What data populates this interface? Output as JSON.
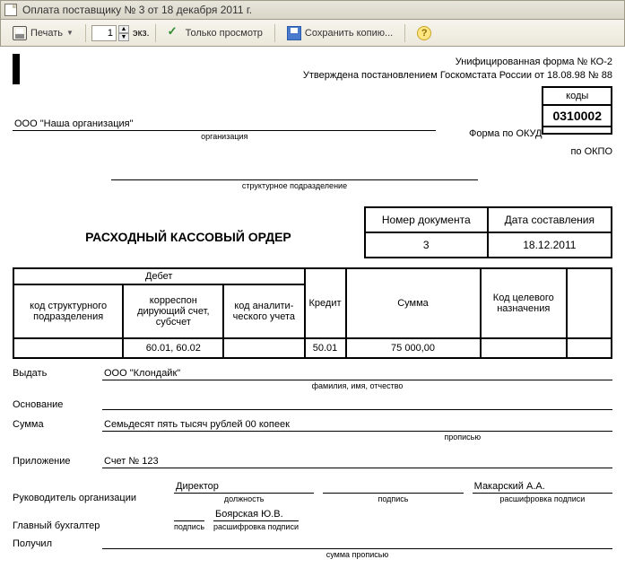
{
  "titlebar": {
    "text": "Оплата поставщику № 3 от 18 декабря 2011 г."
  },
  "toolbar": {
    "print": "Печать",
    "copies": "1",
    "copies_unit": "экз.",
    "view_only": "Только просмотр",
    "save_copy": "Сохранить копию..."
  },
  "header": {
    "form_code_title": "Унифицированная форма № КО-2",
    "approved": "Утверждена постановлением Госкомстата России от 18.08.98 № 88",
    "codes_label": "коды",
    "okud_label": "Форма по ОКУД",
    "okud_value": "0310002",
    "okpo_label": "по ОКПО",
    "okpo_value": ""
  },
  "org": {
    "name": "ООО \"Наша организация\"",
    "org_sub": "организация",
    "subunit_sub": "структурное подразделение"
  },
  "doc": {
    "title": "РАСХОДНЫЙ КАССОВЫЙ ОРДЕР",
    "num_label": "Номер документа",
    "date_label": "Дата составления",
    "num": "3",
    "date": "18.12.2011"
  },
  "table": {
    "debit": "Дебет",
    "struct_code": "код структурного подразделения",
    "corr": "корреспон дирующий счет, субсчет",
    "anal": "код аналити-ческого учета",
    "credit": "Кредит",
    "sum": "Сумма",
    "target": "Код целевого назначения",
    "row": {
      "struct": "",
      "corr": "60.01, 60.02",
      "anal": "",
      "credit": "50.01",
      "sum": "75 000,00",
      "target": "",
      "extra": ""
    }
  },
  "fields": {
    "issue_label": "Выдать",
    "issue_value": "ООО \"Клондайк\"",
    "issue_sub": "фамилия, имя, отчество",
    "basis_label": "Основание",
    "basis_value": "",
    "sum_label": "Сумма",
    "sum_value": "Семьдесят пять тысяч рублей 00 копеек",
    "sum_sub": "прописью",
    "attach_label": "Приложение",
    "attach_value": "Счет № 123"
  },
  "sign": {
    "head_label": "Руководитель организации",
    "head_pos": "Директор",
    "pos_sub": "должность",
    "sign_sub": "подпись",
    "decode_sub": "расшифровка подписи",
    "head_name": "Макарский А.А.",
    "acc_label": "Главный бухгалтер",
    "acc_name": "Боярская Ю.В.",
    "received_label": "Получил",
    "received_sub": "сумма прописью"
  }
}
